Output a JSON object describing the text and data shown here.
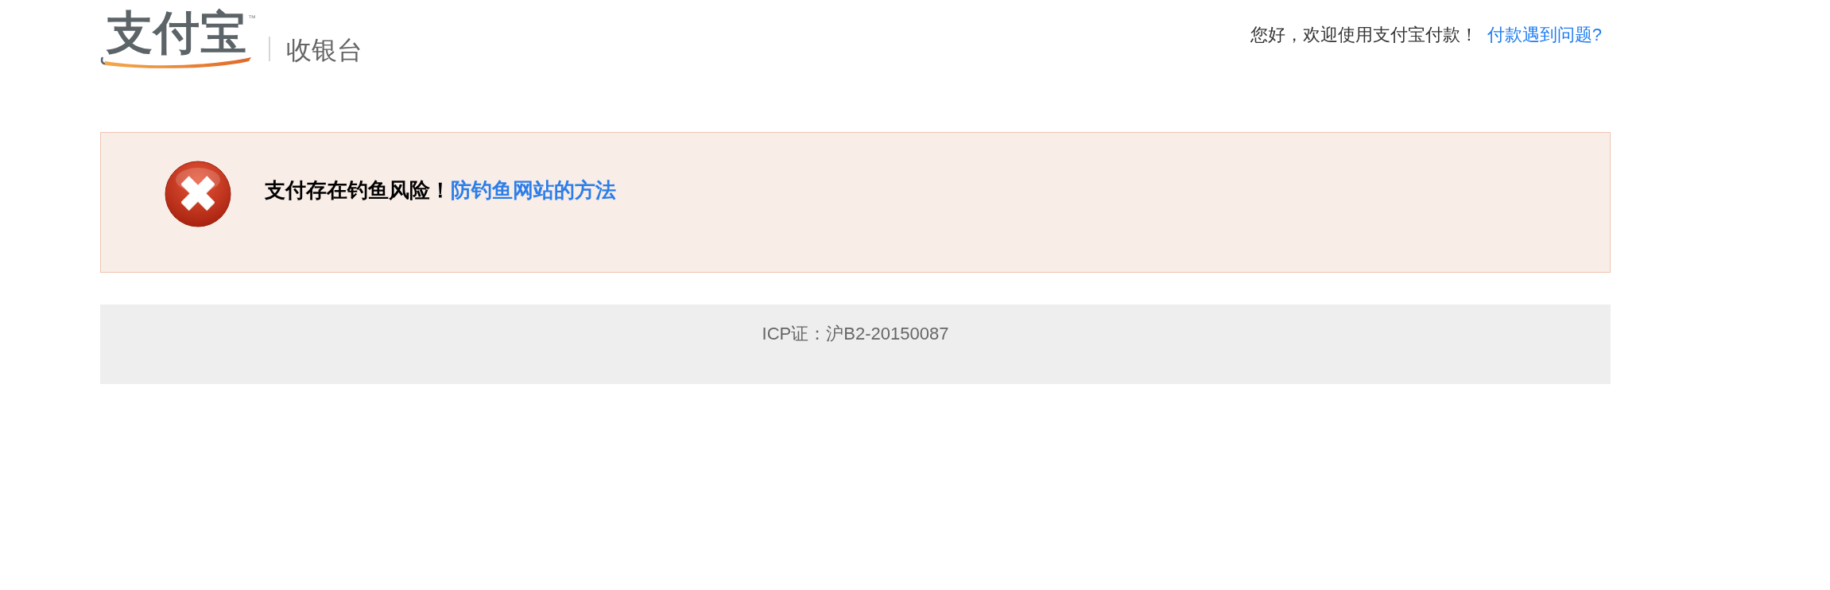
{
  "header": {
    "logo": {
      "text": "支付宝",
      "trademark": "™"
    },
    "product": "收银台",
    "greeting": "您好，欢迎使用支付宝付款！",
    "help_link": "付款遇到问题?"
  },
  "alert": {
    "kind": "error",
    "message": "支付存在钓鱼风险！",
    "link": "防钓鱼网站的方法"
  },
  "footer": {
    "icp": "ICP证：沪B2-20150087"
  }
}
